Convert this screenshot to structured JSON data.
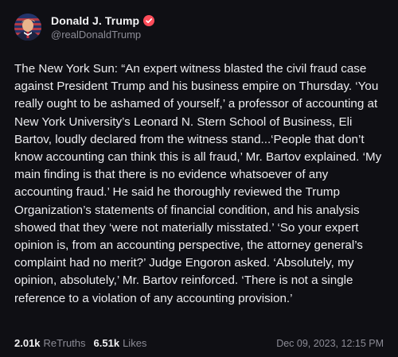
{
  "author": {
    "display_name": "Donald J. Trump",
    "handle": "@realDonaldTrump",
    "avatar_icon": "portrait-avatar",
    "verified_icon": "verified-badge-icon",
    "verified_color": "#ff4d5a"
  },
  "post": {
    "text": "The New York Sun: “An expert witness blasted the civil fraud case against President Trump and his business empire on Thursday. ‘You really ought to be ashamed of yourself,’ a professor of accounting at New York University’s Leonard N. Stern School of Business, Eli Bartov, loudly declared from the witness stand...‘People that don’t know accounting can think this is all fraud,’ Mr. Bartov explained. ‘My main finding is that there is no evidence whatsoever of any accounting fraud.’ He said he thoroughly reviewed the Trump Organization’s statements of financial condition, and his analysis showed that they ‘were not materially misstated.’ ‘So your expert opinion is, from an accounting perspective, the attorney general’s complaint had no merit?’ Judge Engoron asked. ‘Absolutely, my opinion, absolutely,’ Mr. Bartov reinforced. ‘There is not a single reference to a violation of any accounting provision.’"
  },
  "stats": {
    "retruths_count": "2.01k",
    "retruths_label": "ReTruths",
    "likes_count": "6.51k",
    "likes_label": "Likes"
  },
  "timestamp": "Dec 09, 2023, 12:15 PM"
}
